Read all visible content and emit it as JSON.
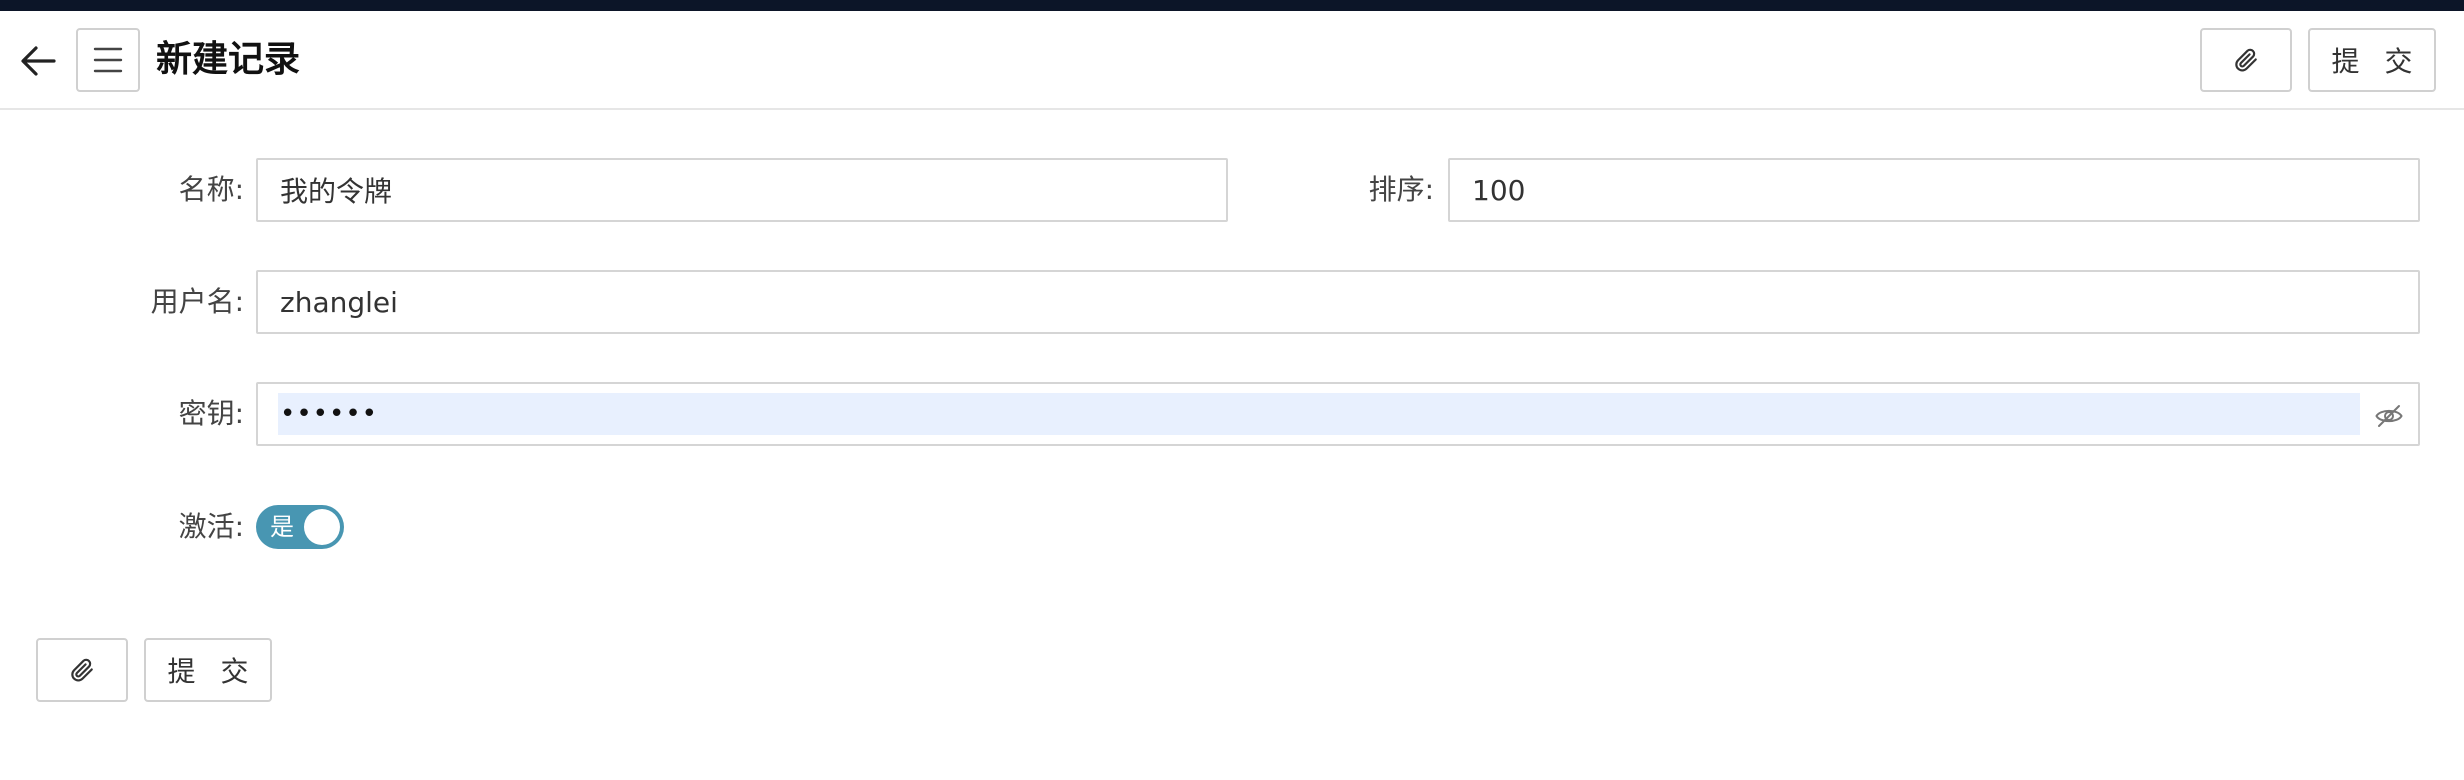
{
  "header": {
    "title": "新建记录",
    "back_icon": "arrow-left-icon",
    "menu_icon": "hamburger-menu-icon",
    "attach_icon": "paperclip-icon",
    "submit_label": "提 交"
  },
  "form": {
    "name_label": "名称:",
    "name_value": "我的令牌",
    "sort_label": "排序:",
    "sort_value": "100",
    "username_label": "用户名:",
    "username_value": "zhanglei",
    "secret_label": "密钥:",
    "secret_masked": "••••••",
    "secret_toggle_icon": "eye-off-icon",
    "active_label": "激活:",
    "active_on_text": "是",
    "active_state": true
  },
  "footer": {
    "attach_icon": "paperclip-icon",
    "submit_label": "提 交"
  },
  "colors": {
    "topbar": "#0c1528",
    "toggle_on": "#4896b2",
    "autofill_bg": "#e8f0fe"
  }
}
